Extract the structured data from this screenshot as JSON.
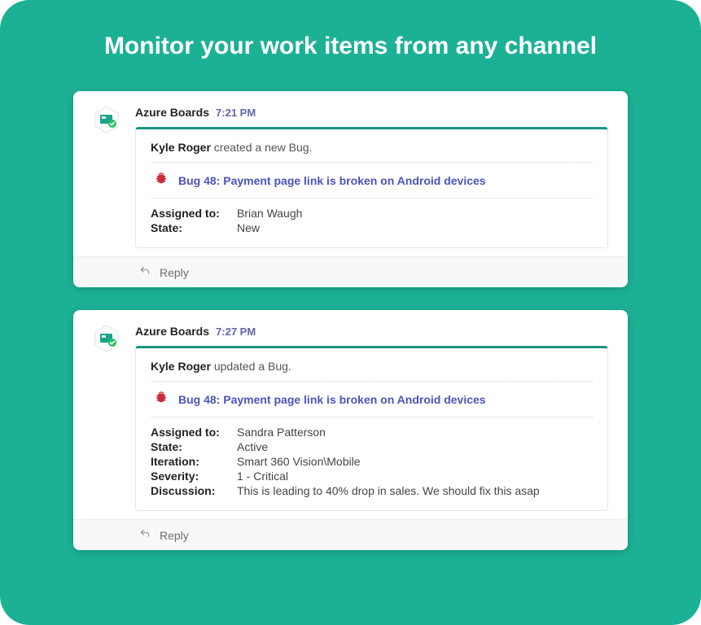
{
  "page": {
    "title": "Monitor your work items from any channel"
  },
  "colors": {
    "background": "#1cb195",
    "accent": "#189680",
    "link": "#4b53bc",
    "timestamp": "#6264a7",
    "bug": "#cc293d"
  },
  "cards": [
    {
      "app_name": "Azure Boards",
      "timestamp": "7:21 PM",
      "actor": "Kyle Roger",
      "action_text": "created a new Bug.",
      "bug_title": "Bug 48: Payment page link is broken on Android devices",
      "fields": [
        {
          "label": "Assigned to:",
          "value": "Brian Waugh"
        },
        {
          "label": "State:",
          "value": "New"
        }
      ],
      "reply_label": "Reply"
    },
    {
      "app_name": "Azure Boards",
      "timestamp": "7:27 PM",
      "actor": "Kyle Roger",
      "action_text": "updated a Bug.",
      "bug_title": "Bug 48: Payment page link is broken on Android devices",
      "fields": [
        {
          "label": "Assigned to:",
          "value": "Sandra Patterson"
        },
        {
          "label": "State:",
          "value": "Active"
        },
        {
          "label": "Iteration:",
          "value": "Smart 360 Vision\\Mobile"
        },
        {
          "label": "Severity:",
          "value": "1 - Critical"
        },
        {
          "label": "Discussion:",
          "value": "This is leading to 40% drop in sales. We should fix this asap"
        }
      ],
      "reply_label": "Reply"
    }
  ],
  "icons": {
    "app_avatar": "azure-boards-icon",
    "bug": "bug-icon",
    "reply": "reply-arrow-icon"
  }
}
